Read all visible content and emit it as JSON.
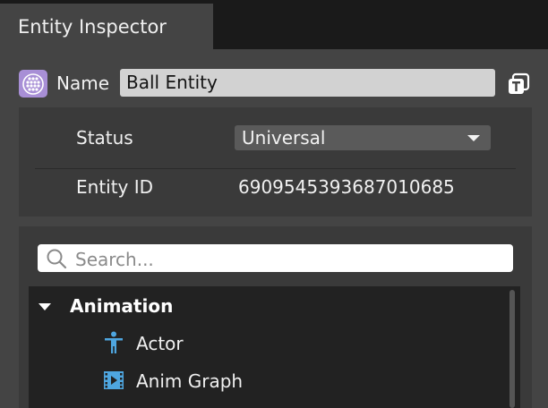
{
  "tab": {
    "title": "Entity Inspector"
  },
  "entity": {
    "name_label": "Name",
    "name_value": "Ball Entity",
    "icon": "entity-icon",
    "pin_icon": "pin-icon"
  },
  "properties": {
    "status_label": "Status",
    "status_value": "Universal",
    "entity_id_label": "Entity ID",
    "entity_id_value": "6909545393687010685"
  },
  "components": {
    "search_placeholder": "Search...",
    "categories": [
      {
        "label": "Animation",
        "expanded": true,
        "items": [
          {
            "label": "Actor",
            "icon": "actor-icon"
          },
          {
            "label": "Anim Graph",
            "icon": "anim-graph-icon"
          }
        ]
      }
    ]
  },
  "colors": {
    "panel_bg": "#444444",
    "accent_icon": "#4ea6e0",
    "entity_icon": "#a88fd6"
  }
}
